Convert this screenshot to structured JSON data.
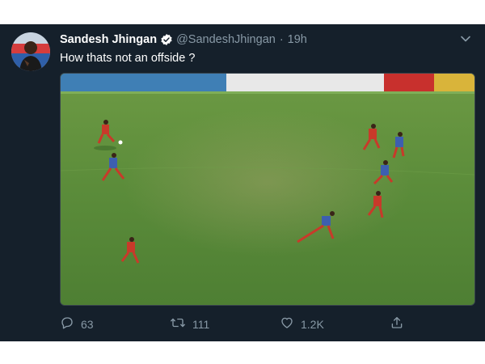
{
  "tweet": {
    "author_name": "Sandesh Jhingan",
    "handle": "@SandeshJhingan",
    "separator": "·",
    "time": "19h",
    "text": "How thats not an offside ?"
  },
  "media": {
    "banner_text_1": "",
    "banner_text_2": "",
    "banner_text_3": ""
  },
  "actions": {
    "reply_count": "63",
    "retweet_count": "111",
    "like_count": "1.2K"
  },
  "colors": {
    "background": "#15202b",
    "text_primary": "#ffffff",
    "text_secondary": "#8899a6",
    "verified": "#ffffff",
    "pitch": "#4a8a3c"
  },
  "icons": [
    "verified-badge-icon",
    "chevron-down-icon",
    "reply-icon",
    "retweet-icon",
    "like-icon",
    "share-icon"
  ]
}
